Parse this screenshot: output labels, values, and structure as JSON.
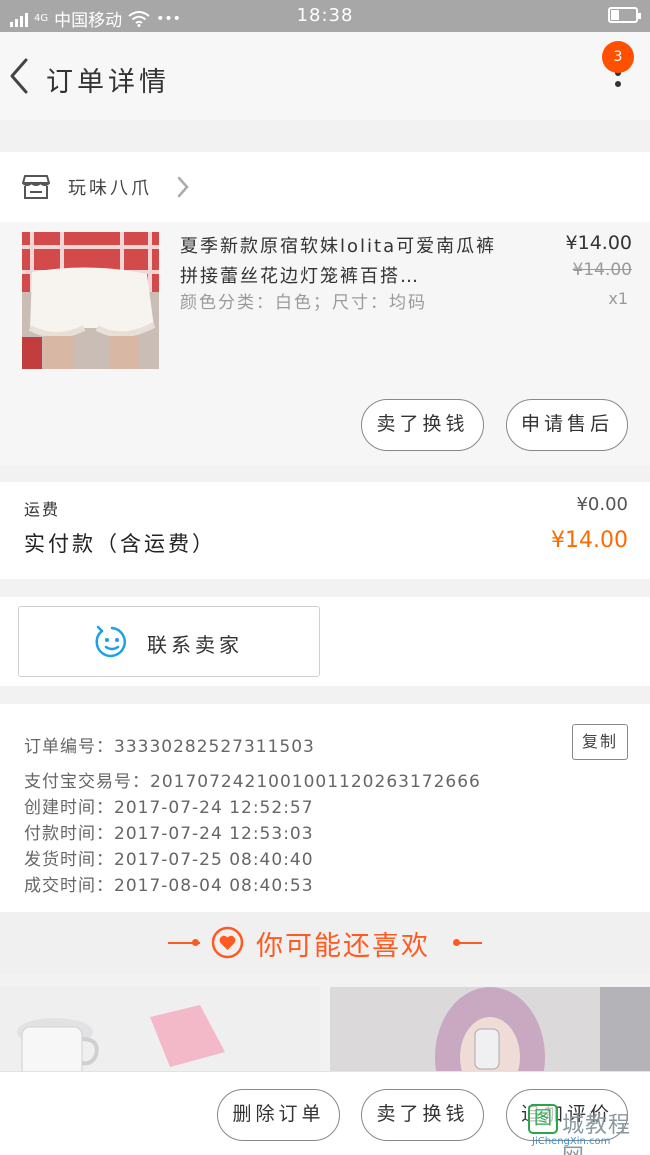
{
  "status_bar": {
    "carrier_text": "中国移动",
    "network_badge": "4G",
    "more_dots": "•••",
    "time": "18:38"
  },
  "nav": {
    "title": "订单详情",
    "notification_count": "3"
  },
  "shop": {
    "name": "玩味八爪"
  },
  "item": {
    "title": "夏季新款原宿软妹lolita可爱南瓜裤拼接蕾丝花边灯笼裤百搭…",
    "sku": "颜色分类：白色；尺寸：均码",
    "price": "¥14.00",
    "original_price": "¥14.00",
    "quantity": "x1",
    "actions": [
      "卖了换钱",
      "申请售后"
    ]
  },
  "fees": {
    "shipping_label": "运费",
    "shipping_value": "¥0.00",
    "paid_label": "实付款（含运费）",
    "paid_value": "¥14.00"
  },
  "contact": {
    "label": "联系卖家"
  },
  "order_info": {
    "lines": [
      "订单编号：333302825273115​03",
      "支付宝交易号：2017072421001001120263172666",
      "创建时间：2017-07-24 12:52:57",
      "付款时间：2017-07-24 12:53:03",
      "发货时间：2017-07-25 08:40:40",
      "成交时间：2017-08-04 08:40:53"
    ],
    "copy_label": "复制"
  },
  "recommend": {
    "title": "你可能还喜欢"
  },
  "bottom_actions": [
    "删除订单",
    "卖了换钱",
    "追加评价"
  ],
  "watermark": {
    "logo_char": "图",
    "text": "城教程网",
    "url": "JiChengXin.com"
  },
  "colors": {
    "accent": "#ff5a1f",
    "price_highlight": "#ff6a00",
    "status_bar": "#a7a7a7"
  }
}
